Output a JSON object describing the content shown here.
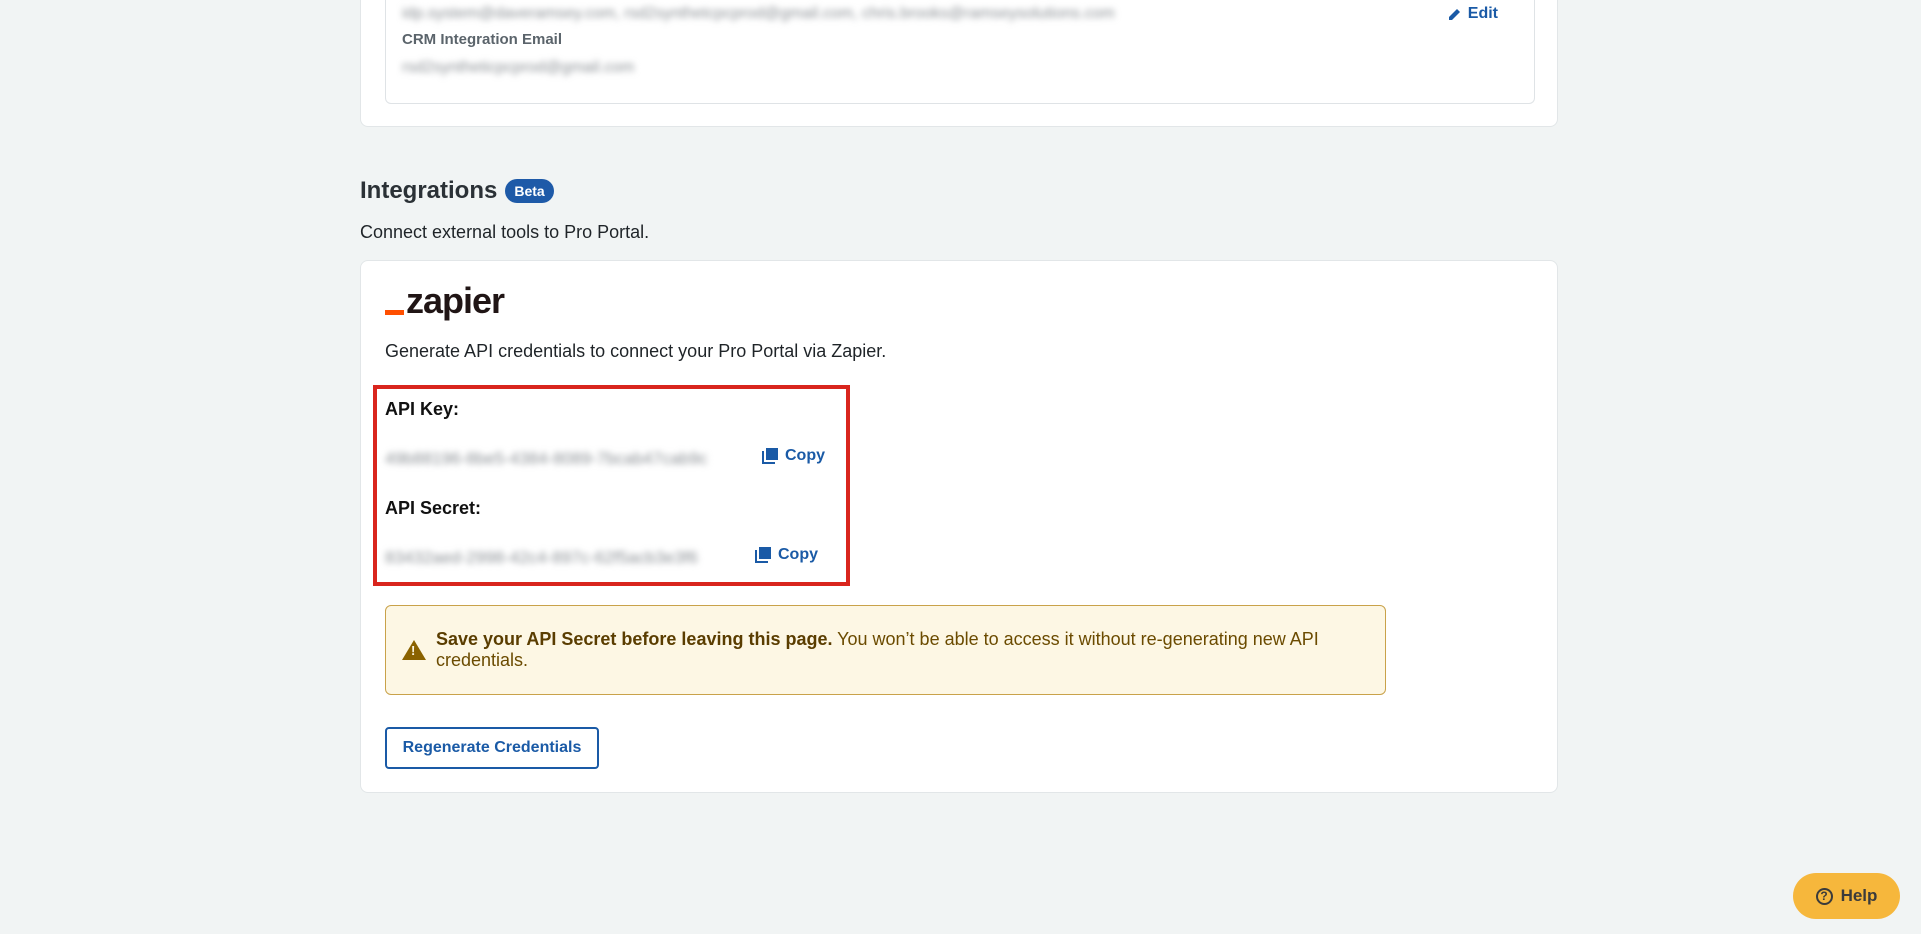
{
  "top_card": {
    "emails_blurred": "idp.system@daveramsey.com, rsd2synthetcpcprod@gmail.com, chris.brooks@ramseysolutions.com",
    "edit_label": "Edit",
    "crm_label": "CRM Integration Email",
    "crm_value_blurred": "rsd2syntheticpcprod@gmail.com"
  },
  "integrations": {
    "title": "Integrations",
    "badge": "Beta",
    "subtitle": "Connect external tools to Pro Portal.",
    "zapier": {
      "logo_text": "zapier",
      "description": "Generate API credentials to connect your Pro Portal via Zapier.",
      "api_key_label": "API Key:",
      "api_key_value": "49b88196-8be5-4384-8089-7bcab47cab9c",
      "api_secret_label": "API Secret:",
      "api_secret_value": "83432aed-2998-42c4-897c-62f5acb3e3f6",
      "copy_label": "Copy",
      "warning_strong": "Save your API Secret before leaving this page.",
      "warning_text": " You won’t be able to access it without re-generating new API credentials.",
      "regenerate_label": "Regenerate Credentials"
    }
  },
  "help": {
    "label": "Help"
  },
  "colors": {
    "accent": "#1a5aa6",
    "highlight_box": "#d9251d",
    "zapier_orange": "#ff4f00",
    "warning_bg": "#fdf7e4",
    "help_button": "#f6b73c"
  }
}
